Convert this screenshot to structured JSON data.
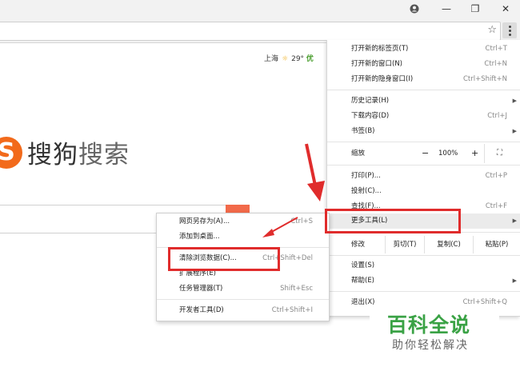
{
  "window": {
    "profile_icon": "profile-icon",
    "minimize": "—",
    "restore": "❐",
    "close": "✕"
  },
  "toolbar": {
    "star_icon": "☆"
  },
  "page": {
    "weather_city": "上海",
    "weather_temp": "29°",
    "weather_quality": "优",
    "logo_letter": "S",
    "logo_text_1": "搜狗",
    "logo_text_2": "搜索"
  },
  "menu": {
    "new_tab": {
      "label": "打开新的标签页(T)",
      "shortcut": "Ctrl+T"
    },
    "new_window": {
      "label": "打开新的窗口(N)",
      "shortcut": "Ctrl+N"
    },
    "new_incognito": {
      "label": "打开新的隐身窗口(I)",
      "shortcut": "Ctrl+Shift+N"
    },
    "history": {
      "label": "历史记录(H)"
    },
    "downloads": {
      "label": "下载内容(D)",
      "shortcut": "Ctrl+J"
    },
    "bookmarks": {
      "label": "书签(B)"
    },
    "zoom": {
      "label": "缩放",
      "minus": "−",
      "value": "100%",
      "plus": "+",
      "fullscreen": "⛶"
    },
    "print": {
      "label": "打印(P)...",
      "shortcut": "Ctrl+P"
    },
    "cast": {
      "label": "投射(C)..."
    },
    "find": {
      "label": "查找(F)...",
      "shortcut": "Ctrl+F"
    },
    "more_tools": {
      "label": "更多工具(L)"
    },
    "edit": {
      "label": "修改",
      "cut": "剪切(T)",
      "copy": "复制(C)",
      "paste": "粘贴(P)"
    },
    "settings": {
      "label": "设置(S)"
    },
    "help": {
      "label": "帮助(E)"
    },
    "exit": {
      "label": "退出(X)",
      "shortcut": "Ctrl+Shift+Q"
    }
  },
  "submenu": {
    "save_page": {
      "label": "网页另存为(A)...",
      "shortcut": "Ctrl+S"
    },
    "add_desktop": {
      "label": "添加到桌面..."
    },
    "clear_data": {
      "label": "清除浏览数据(C)...",
      "shortcut": "Ctrl+Shift+Del"
    },
    "extensions": {
      "label": "扩展程序(E)"
    },
    "task_manager": {
      "label": "任务管理器(T)",
      "shortcut": "Shift+Esc"
    },
    "dev_tools": {
      "label": "开发者工具(D)",
      "shortcut": "Ctrl+Shift+I"
    }
  },
  "watermark": {
    "title": "百科全说",
    "subtitle": "助你轻松解决"
  },
  "colors": {
    "highlight": "#e02c2c",
    "brand_orange": "#f26a1b",
    "watermark_green": "#3aa245"
  }
}
